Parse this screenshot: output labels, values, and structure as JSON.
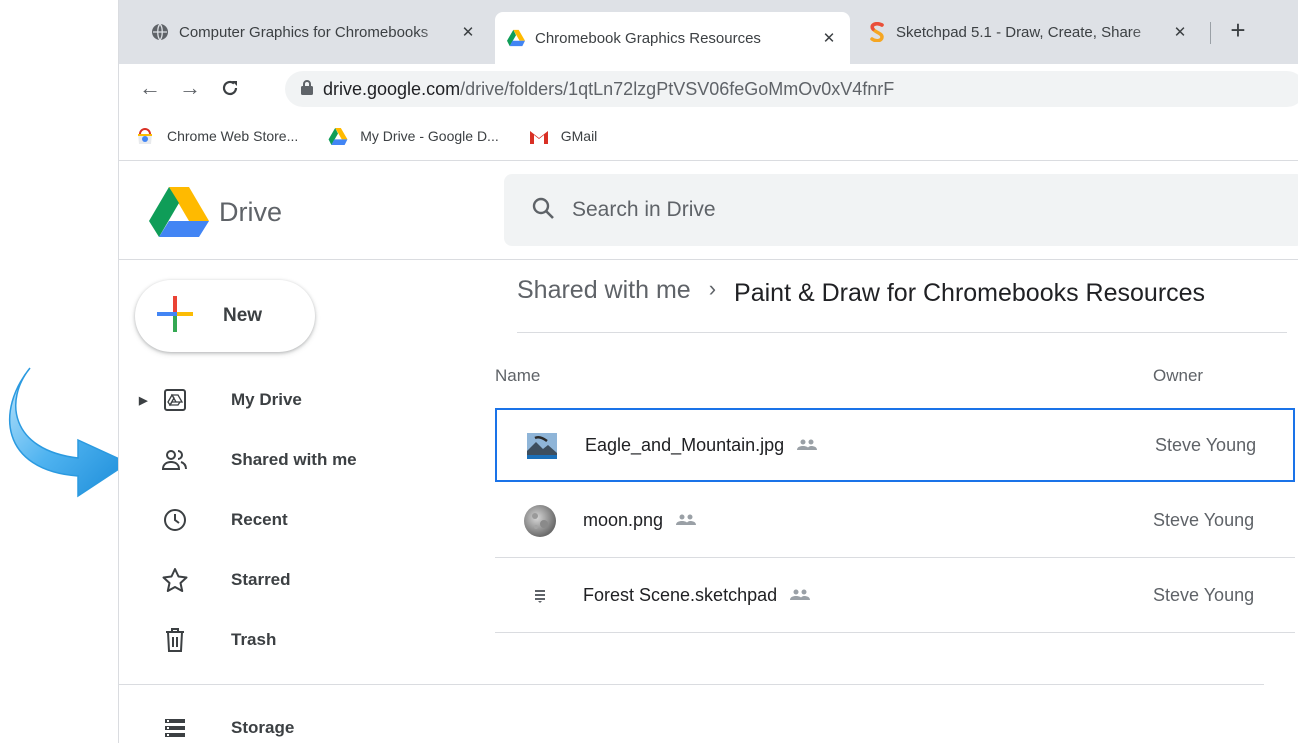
{
  "browser": {
    "tabs": [
      {
        "title": "Computer Graphics for Chromebooks",
        "icon": "globe-icon",
        "close": "✕",
        "active": false
      },
      {
        "title": "Chromebook Graphics Resources",
        "icon": "google-drive-icon",
        "close": "✕",
        "active": true
      },
      {
        "title": "Sketchpad 5.1 - Draw, Create, Share",
        "icon": "sketchpad-icon",
        "close": "✕",
        "active": false
      }
    ],
    "new_tab": "+",
    "url_host": "drive.google.com",
    "url_path": "/drive/folders/1qtLn72lzgPtVSV06feGoMmOv0xV4fnrF",
    "bookmarks": [
      {
        "label": "Chrome Web Store...",
        "icon": "chrome-web-store-icon"
      },
      {
        "label": "My Drive - Google D...",
        "icon": "google-drive-icon"
      },
      {
        "label": "GMail",
        "icon": "gmail-icon"
      }
    ]
  },
  "drive": {
    "logo_text": "Drive",
    "search_placeholder": "Search in Drive",
    "new_button": "New",
    "nav": [
      {
        "label": "My Drive",
        "icon": "my-drive-icon"
      },
      {
        "label": "Shared with me",
        "icon": "people-icon"
      },
      {
        "label": "Recent",
        "icon": "clock-icon"
      },
      {
        "label": "Starred",
        "icon": "star-icon"
      },
      {
        "label": "Trash",
        "icon": "trash-icon"
      },
      {
        "label": "Storage",
        "icon": "storage-icon"
      }
    ],
    "breadcrumb": {
      "parent": "Shared with me",
      "separator": "›",
      "current": "Paint & Draw for Chromebooks Resources"
    },
    "columns": {
      "name": "Name",
      "owner": "Owner"
    },
    "files": [
      {
        "name": "Eagle_and_Mountain.jpg",
        "owner": "Steve Young",
        "icon": "image-thumbnail-icon",
        "selected": true
      },
      {
        "name": "moon.png",
        "owner": "Steve Young",
        "icon": "moon-thumbnail-icon",
        "selected": false
      },
      {
        "name": "Forest Scene.sketchpad",
        "owner": "Steve Young",
        "icon": "document-icon",
        "selected": false
      }
    ]
  },
  "colors": {
    "accent": "#1a73e8",
    "selected_border": "#1a73e8",
    "arrow": "#4fb3f0"
  }
}
